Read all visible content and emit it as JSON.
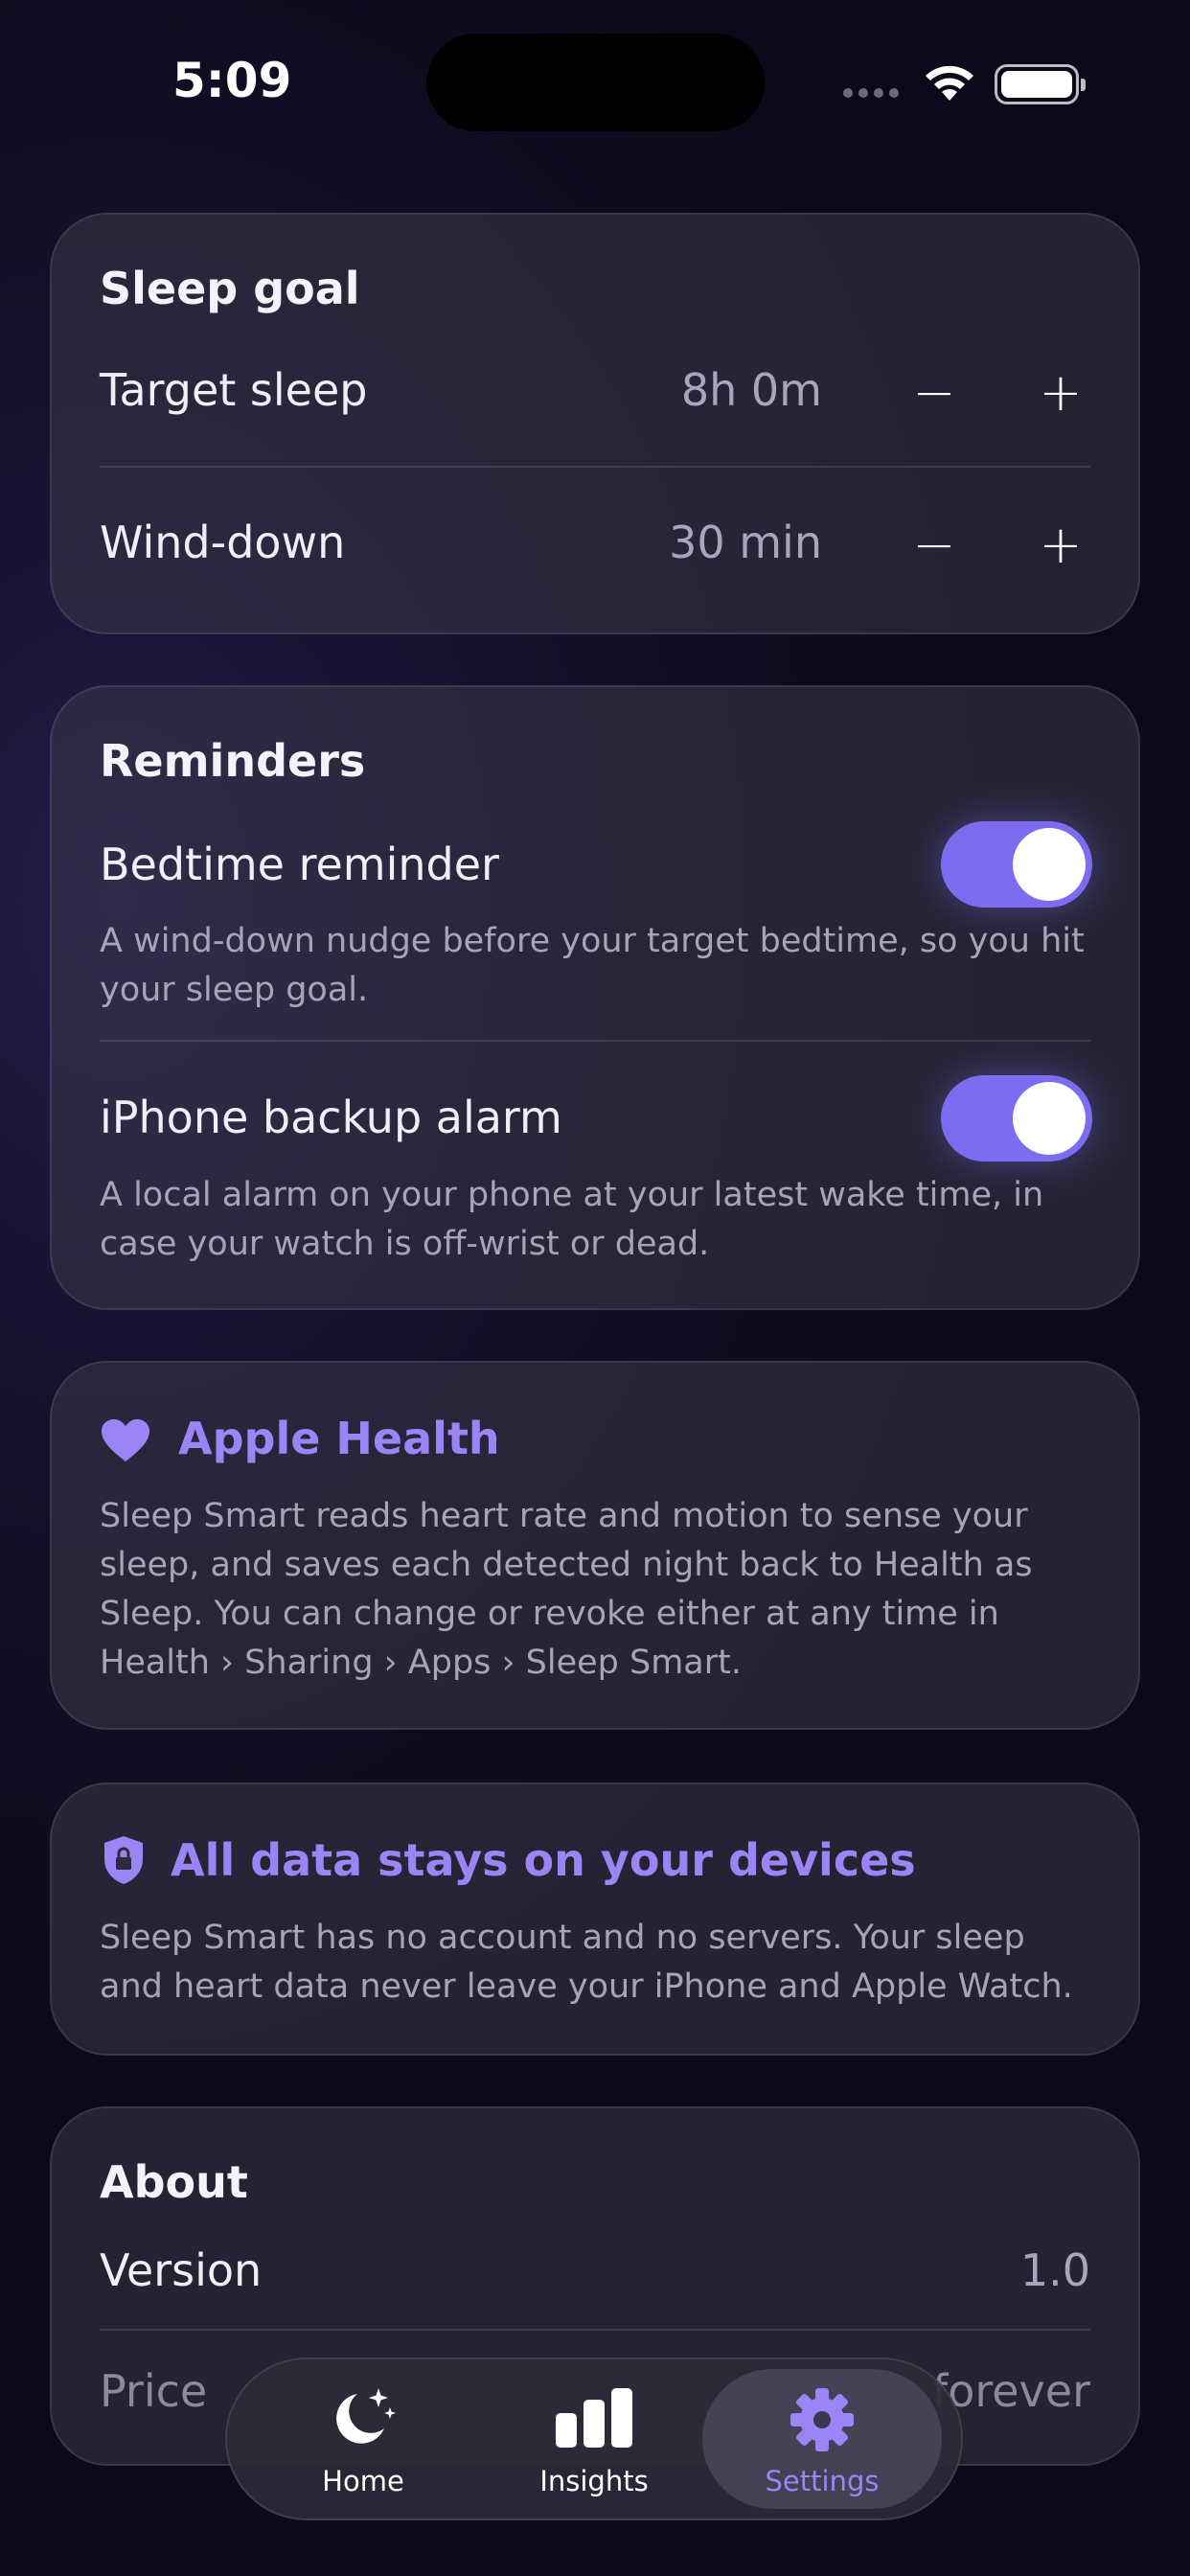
{
  "status_bar": {
    "time": "5:09"
  },
  "sleep_goal": {
    "title": "Sleep goal",
    "rows": [
      {
        "label": "Target sleep",
        "value": "8h 0m",
        "minus": "−",
        "plus": "+"
      },
      {
        "label": "Wind-down",
        "value": "30 min",
        "minus": "−",
        "plus": "+"
      }
    ]
  },
  "reminders": {
    "title": "Reminders",
    "items": [
      {
        "label": "Bedtime reminder",
        "enabled": true,
        "description": "A wind-down nudge before your target bedtime, so you hit your sleep goal."
      },
      {
        "label": "iPhone backup alarm",
        "enabled": true,
        "description": "A local alarm on your phone at your latest wake time, in case your watch is off-wrist or dead."
      }
    ]
  },
  "apple_health": {
    "icon": "heart-icon",
    "title": "Apple Health",
    "description": "Sleep Smart reads heart rate and motion to sense your sleep, and saves each detected night back to Health as Sleep. You can change or revoke either at any time in Health › Sharing › Apps › Sleep Smart."
  },
  "privacy": {
    "icon": "lock-shield-icon",
    "title": "All data stays on your devices",
    "description": "Sleep Smart has no account and no servers. Your sleep and heart data never leave your iPhone and Apple Watch."
  },
  "about": {
    "title": "About",
    "rows": [
      {
        "label": "Version",
        "value": "1.0"
      },
      {
        "label": "Price",
        "value": "forever"
      }
    ]
  },
  "tab_bar": {
    "tabs": [
      {
        "label": "Home",
        "icon": "moon-stars-icon",
        "active": false
      },
      {
        "label": "Insights",
        "icon": "bar-chart-icon",
        "active": false
      },
      {
        "label": "Settings",
        "icon": "gear-icon",
        "active": true
      }
    ]
  },
  "colors": {
    "accent": "#9b84f6",
    "toggle_on": "#7b6cf0",
    "background": "#14112b"
  }
}
